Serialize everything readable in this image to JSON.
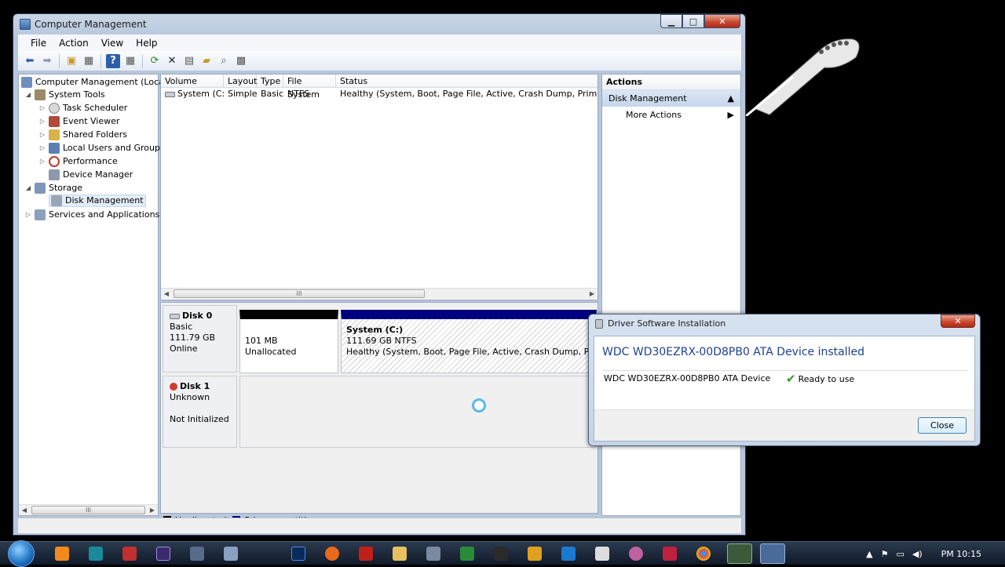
{
  "window": {
    "title": "Computer Management"
  },
  "menu": [
    "File",
    "Action",
    "View",
    "Help"
  ],
  "tree": {
    "root": "Computer Management (Local",
    "items": [
      "System Tools",
      "Task Scheduler",
      "Event Viewer",
      "Shared Folders",
      "Local Users and Groups",
      "Performance",
      "Device Manager",
      "Storage",
      "Disk Management",
      "Services and Applications"
    ]
  },
  "volumes": {
    "columns": [
      "Volume",
      "Layout",
      "Type",
      "File System",
      "Status"
    ],
    "rows": [
      [
        "System (C:)",
        "Simple",
        "Basic",
        "NTFS",
        "Healthy (System, Boot, Page File, Active, Crash Dump, Primary Pa"
      ]
    ]
  },
  "disks": [
    {
      "name": "Disk 0",
      "type": "Basic",
      "size": "111.79 GB",
      "state": "Online"
    },
    {
      "name": "Disk 1",
      "type": "Unknown",
      "state": "Not Initialized"
    }
  ],
  "partitions": {
    "unalloc": {
      "size": "101 MB",
      "label": "Unallocated"
    },
    "system": {
      "name": "System  (C:)",
      "size": "111.69 GB NTFS",
      "status": "Healthy (System, Boot, Page File, Active, Crash Dump, Primary"
    }
  },
  "legend": [
    "Unallocated",
    "Primary partition"
  ],
  "actions": {
    "header": "Actions",
    "section": "Disk Management",
    "more": "More Actions"
  },
  "dialog": {
    "title": "Driver Software Installation",
    "heading": "WDC WD30EZRX-00D8PB0 ATA Device installed",
    "device": "WDC WD30EZRX-00D8PB0 ATA Device",
    "status": "Ready to use",
    "close": "Close"
  },
  "tray": {
    "time": "PM 10:15"
  },
  "colors": {
    "unallocated": "#000000",
    "primary": "#000080",
    "selection": "#e3edf9"
  }
}
